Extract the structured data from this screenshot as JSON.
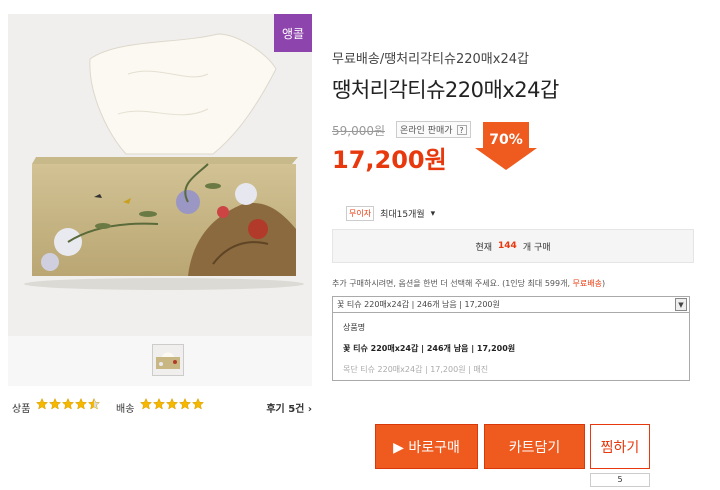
{
  "badge": "앵콜",
  "product": {
    "subtitle": "무료배송/땡처리각티슈220매x24갑",
    "title": "땡처리각티슈220매x24갑",
    "original_price": "59,000원",
    "online_tag": "온라인 판매가",
    "online_tag_help": "?",
    "price": "17,200원",
    "discount": "70%"
  },
  "ratings": {
    "product_label": "상품",
    "product_stars": 4.5,
    "delivery_label": "배송",
    "delivery_stars": 5,
    "review_link": "후기 5건 ›"
  },
  "shipping": {
    "tag": "무이자",
    "text": "최대15개월",
    "chevron": "▾"
  },
  "current": {
    "prefix": "현재",
    "count": "144",
    "suffix": "개 구매"
  },
  "option_note": {
    "text": "추가 구매하시려면, 옵션을 한번 더 선택해 주세요. (1인당 최대 599개,",
    "highlight": "무료배송",
    "close": ")"
  },
  "select": {
    "value": "꽃 티슈 220매x24갑  |  246개 남음  |  17,200원",
    "arrow": "▼"
  },
  "options": [
    {
      "label": "상품명"
    },
    {
      "label": "꽃 티슈 220매x24갑  |  246개 남음  |  17,200원"
    },
    {
      "label": "목단 티슈 220매x24갑  |  17,200원  |  매진"
    }
  ],
  "buttons": {
    "buy": "▶ 바로구매",
    "cart": "카트담기",
    "fav": "찜하기",
    "fav_count": "5"
  },
  "colors": {
    "accent": "#e8380d",
    "button": "#ef5a1e",
    "star": "#f5b700",
    "badge": "#8e44ad"
  }
}
